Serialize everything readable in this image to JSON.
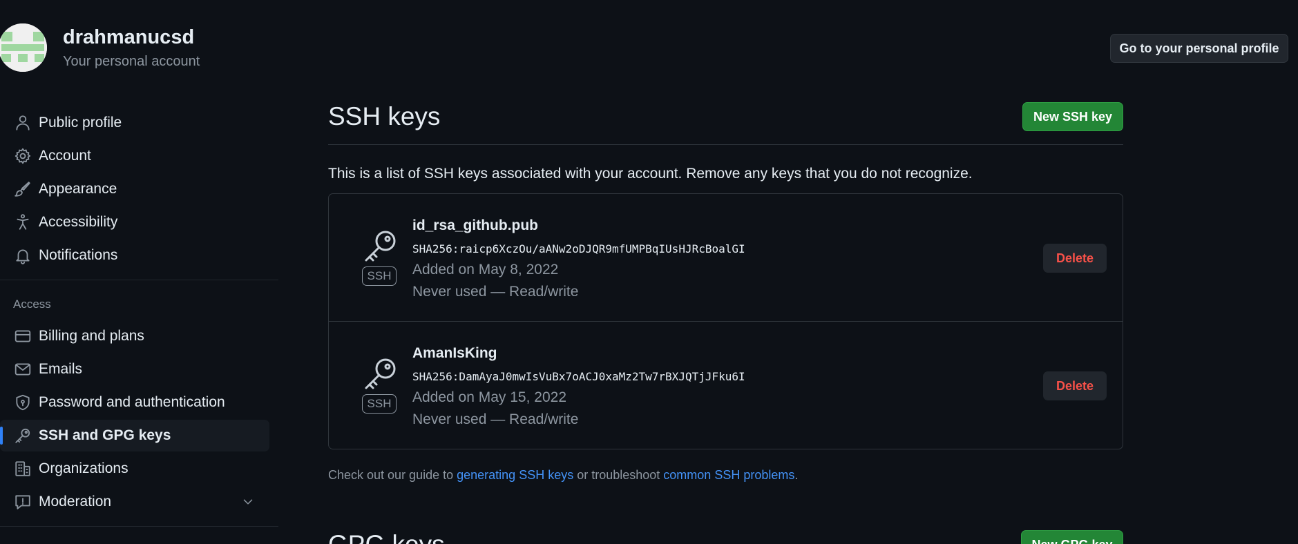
{
  "account": {
    "username": "drahmanucsd",
    "subtitle": "Your personal account",
    "profile_button": "Go to your personal profile"
  },
  "sidebar": {
    "items": [
      {
        "label": "Public profile",
        "icon": "person-icon"
      },
      {
        "label": "Account",
        "icon": "gear-icon"
      },
      {
        "label": "Appearance",
        "icon": "paintbrush-icon"
      },
      {
        "label": "Accessibility",
        "icon": "accessibility-icon"
      },
      {
        "label": "Notifications",
        "icon": "bell-icon"
      }
    ],
    "access_title": "Access",
    "access_items": [
      {
        "label": "Billing and plans",
        "icon": "credit-card-icon"
      },
      {
        "label": "Emails",
        "icon": "mail-icon"
      },
      {
        "label": "Password and authentication",
        "icon": "shield-lock-icon"
      },
      {
        "label": "SSH and GPG keys",
        "icon": "key-icon",
        "active": true
      },
      {
        "label": "Organizations",
        "icon": "organization-icon"
      },
      {
        "label": "Moderation",
        "icon": "report-icon"
      }
    ]
  },
  "ssh": {
    "title": "SSH keys",
    "new_button": "New SSH key",
    "intro": "This is a list of SSH keys associated with your account. Remove any keys that you do not recognize.",
    "keys": [
      {
        "name": "id_rsa_github.pub",
        "fingerprint": "SHA256:raicp6XczOu/aANw2oDJQR9mfUMPBqIUsHJRcBoalGI",
        "added": "Added on May 8, 2022",
        "usage": "Never used — Read/write",
        "badge": "SSH",
        "delete_label": "Delete"
      },
      {
        "name": "AmanIsKing",
        "fingerprint": "SHA256:DamAyaJ0mwIsVuBx7oACJ0xaMz2Tw7rBXJQTjJFku6I",
        "added": "Added on May 15, 2022",
        "usage": "Never used — Read/write",
        "badge": "SSH",
        "delete_label": "Delete"
      }
    ],
    "guide": {
      "prefix": "Check out our guide to ",
      "link1": "generating SSH keys",
      "middle": " or troubleshoot ",
      "link2": "common SSH problems",
      "suffix": "."
    }
  },
  "gpg": {
    "title": "GPG keys",
    "new_button": "New GPG key"
  },
  "colors": {
    "background": "#0d1117",
    "primary_button": "#238636",
    "danger": "#f85149",
    "link": "#4493f8",
    "active_indicator": "#2f81f7"
  }
}
